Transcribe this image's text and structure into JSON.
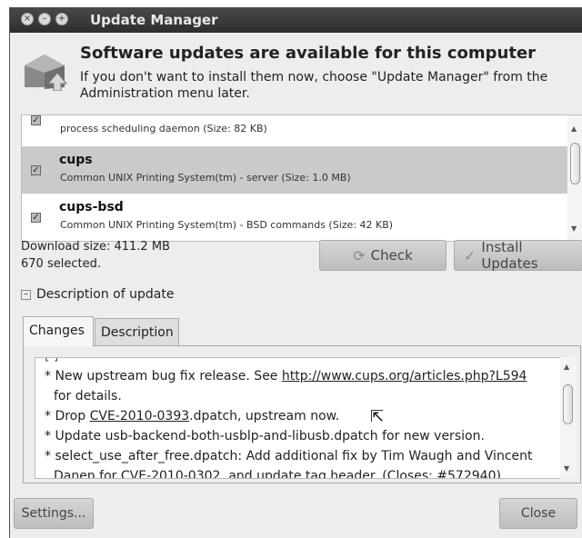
{
  "window": {
    "title": "Update Manager"
  },
  "header": {
    "title": "Software updates are available for this computer",
    "subtitle": "If you don't want to install them now, choose \"Update Manager\" from the Administration menu later."
  },
  "packages": [
    {
      "name": "",
      "description": "process scheduling daemon (Size: 82 KB)",
      "checked": true
    },
    {
      "name": "cups",
      "description": "Common UNIX Printing System(tm) - server (Size: 1.0 MB)",
      "checked": true
    },
    {
      "name": "cups-bsd",
      "description": "Common UNIX Printing System(tm) - BSD commands (Size: 42 KB)",
      "checked": true
    }
  ],
  "status": {
    "download_size": "Download size: 411.2 MB",
    "selected": "670 selected."
  },
  "buttons": {
    "check": "Check",
    "install": "Install Updates",
    "settings": "Settings...",
    "close": "Close"
  },
  "expander": {
    "label": "Description of update"
  },
  "tabs": [
    "Changes",
    "Description"
  ],
  "changelog": {
    "line1_prefix": "* New upstream bug fix release. See ",
    "line1_link": "http://www.cups.org/articles.php?L594",
    "line2": "for details.",
    "line3_prefix": "* Drop ",
    "line3_link": "CVE-2010-0393",
    "line3_suffix": ".dpatch, upstream now.",
    "line4": "* Update usb-backend-both-usblp-and-libusb.dpatch for new version.",
    "line5": "* select_use_after_free.dpatch: Add additional fix by Tim Waugh and Vincent",
    "line6": "Danen for CVE-2010-0302, and update tag header. (Closes: #572940)"
  },
  "icons": {
    "check": "refresh-icon",
    "install": "checkmark-icon",
    "cursor": "mouse-pointer-icon"
  }
}
